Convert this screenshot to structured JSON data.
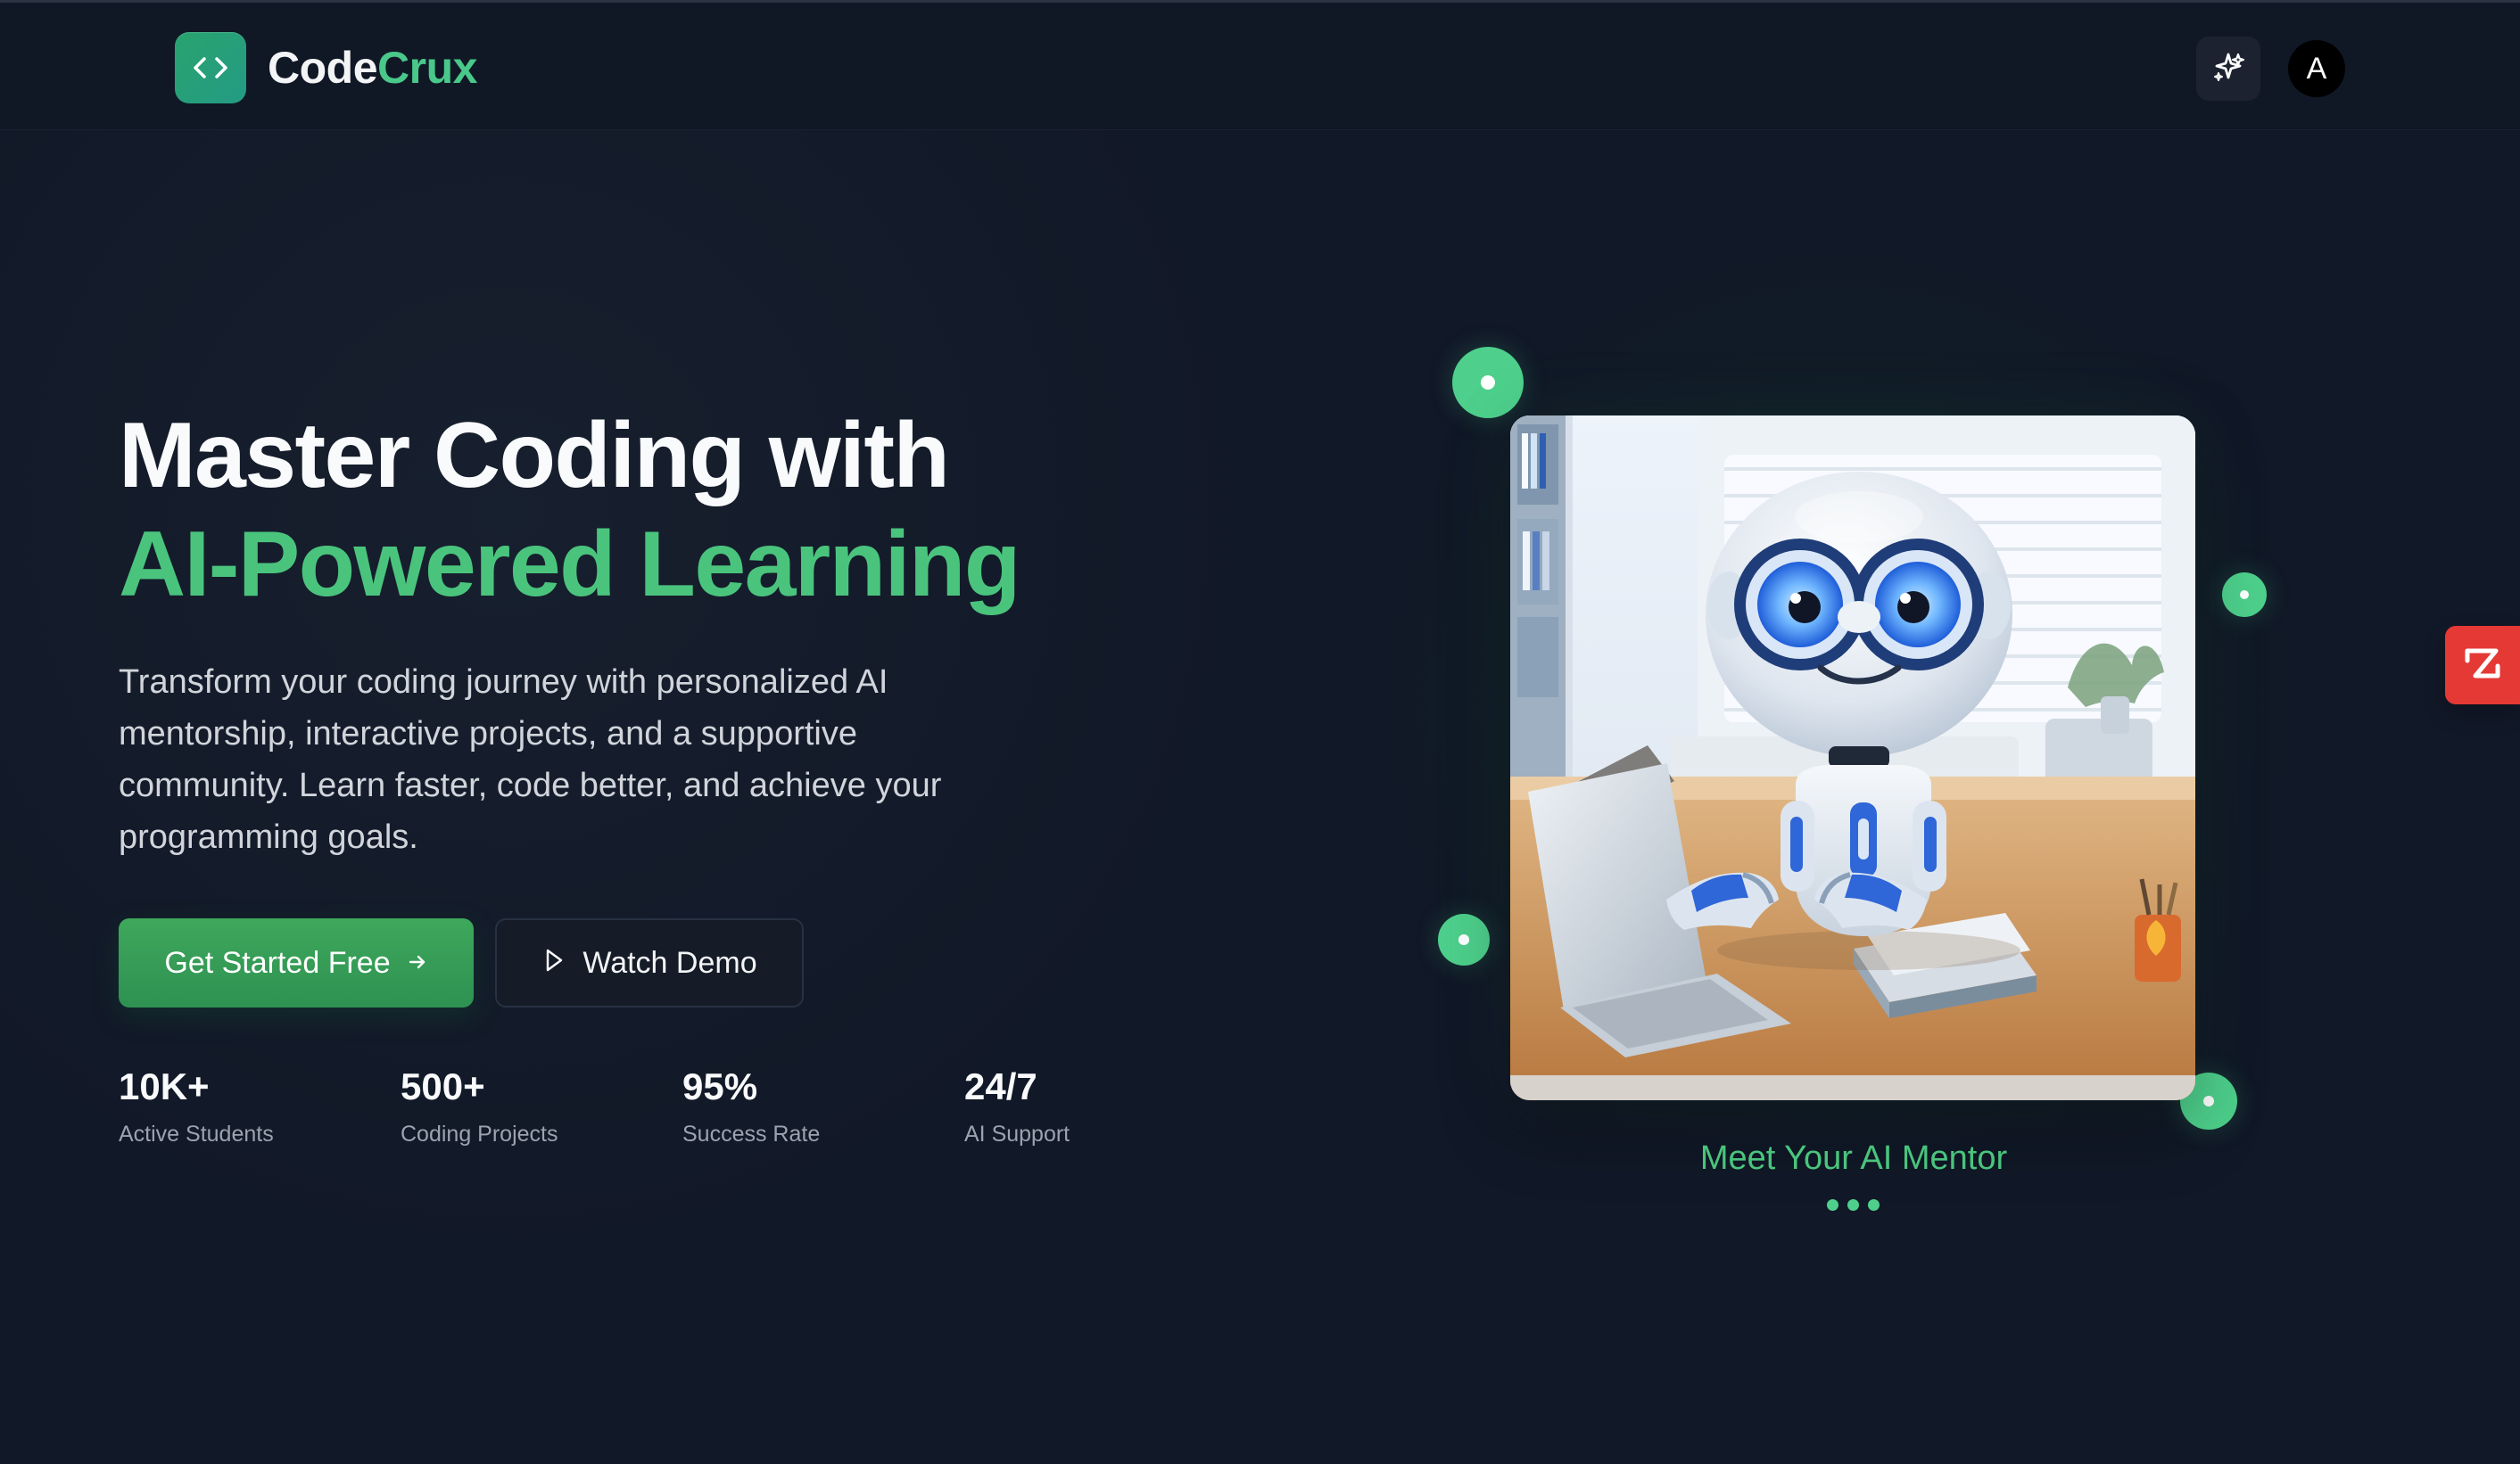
{
  "header": {
    "brand": {
      "code": "Code",
      "crux": "Crux"
    },
    "actions": {
      "sparkle_icon": "sparkle-icon",
      "avatar_label": "A"
    }
  },
  "hero": {
    "title_line1": "Master Coding with",
    "title_line2": "AI-Powered Learning",
    "description": "Transform your coding journey with personalized AI mentorship, interactive projects, and a supportive community. Learn faster, code better, and achieve your programming goals.",
    "primary_cta": "Get Started Free",
    "secondary_cta": "Watch Demo"
  },
  "stats": [
    {
      "value": "10K+",
      "label": "Active Students"
    },
    {
      "value": "500+",
      "label": "Coding Projects"
    },
    {
      "value": "95%",
      "label": "Success Rate"
    },
    {
      "value": "24/7",
      "label": "AI Support"
    }
  ],
  "mentor": {
    "title": "Meet Your AI Mentor"
  },
  "colors": {
    "background": "#111827",
    "accent": "#4ac47d",
    "button_primary": "#3ea85b",
    "badge": "#e53935"
  },
  "icons": {
    "logo": "code-brackets-icon",
    "header_action": "sparkle-icon",
    "primary_cta": "arrow-right-icon",
    "secondary_cta": "play-icon",
    "edge_badge": "z-logo-icon"
  }
}
